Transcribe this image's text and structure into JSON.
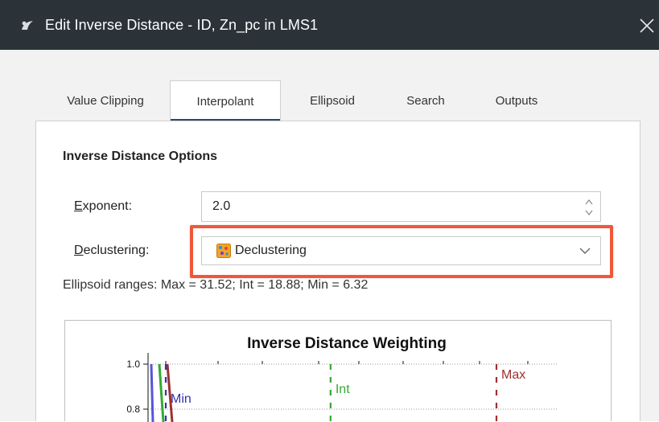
{
  "window": {
    "title": "Edit Inverse Distance - ID, Zn_pc in LMS1",
    "icon": "leapfrog-app-icon",
    "titlebar_color": "#2b3238"
  },
  "tabs": [
    {
      "label": "Value Clipping",
      "active": false
    },
    {
      "label": "Interpolant",
      "active": true
    },
    {
      "label": "Ellipsoid",
      "active": false
    },
    {
      "label": "Search",
      "active": false
    },
    {
      "label": "Outputs",
      "active": false
    }
  ],
  "options": {
    "section_title": "Inverse Distance Options",
    "exponent": {
      "label": "Exponent:",
      "value": "2.0"
    },
    "declustering": {
      "label": "Declustering:",
      "value": "Declustering",
      "icon": "declustering-object-icon"
    },
    "ellipsoid_ranges": "Ellipsoid ranges:  Max = 31.52; Int = 18.88; Min = 6.32"
  },
  "highlight_color": "#f0573a",
  "chart_data": {
    "type": "line",
    "title": "Inverse Distance Weighting",
    "y_ticks": [
      "1.0",
      "0.8"
    ],
    "ylim": [
      0.75,
      1.05
    ],
    "markers": [
      {
        "name": "Min",
        "x": 6.32,
        "color": "#3333aa"
      },
      {
        "name": "Int",
        "x": 18.88,
        "color": "#33aa33"
      },
      {
        "name": "Max",
        "x": 31.52,
        "color": "#a03030"
      }
    ],
    "series_colors": [
      "#5555dd",
      "#33aa33",
      "#a03030"
    ],
    "grid": true
  }
}
